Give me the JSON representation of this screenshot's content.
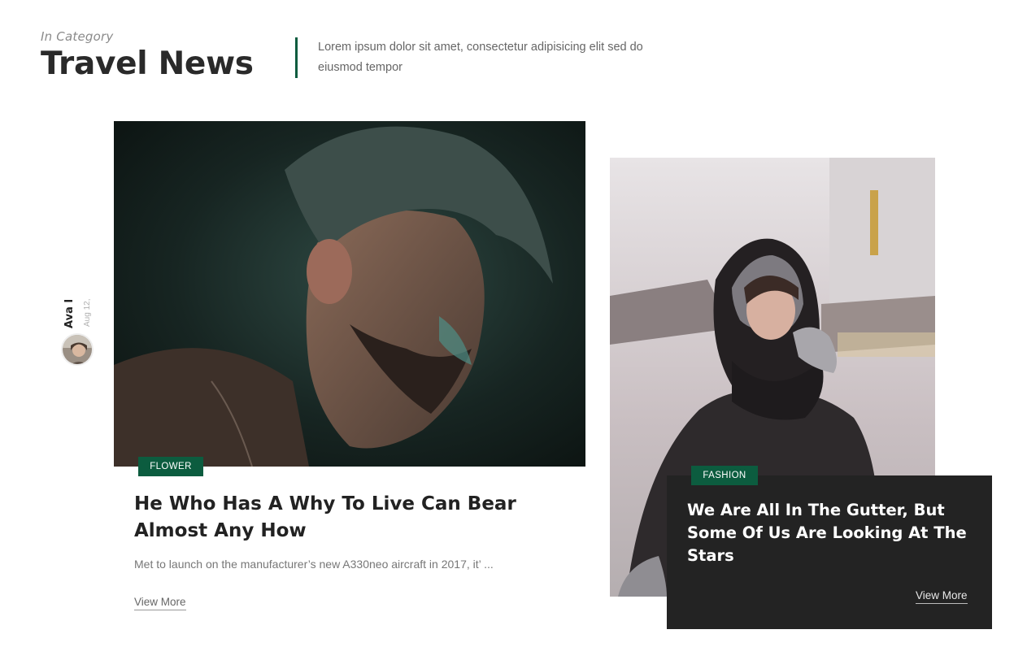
{
  "section": {
    "eyebrow": "In Category",
    "title": "Travel News",
    "description": "Lorem ipsum dolor sit amet, consectetur adipisicing elit sed do eiusmod tempor"
  },
  "author": {
    "name": "Ava I",
    "date": "Aug 12,"
  },
  "main_post": {
    "image_alt": "man with beard in dim light",
    "tag": "FLOWER",
    "title": "He Who Has A Why To Live Can Bear Almost Any How",
    "excerpt": "Met to launch on the manufacturer’s new A330neo aircraft in 2017, it’ ...",
    "link": "View More"
  },
  "side_post": {
    "image_alt": "woman in hood on snowy street",
    "tag": "FASHION",
    "title": "We Are All In The Gutter, But Some Of Us Are Looking At The Stars",
    "link": "View More"
  },
  "colors": {
    "accent": "#0c5c3f",
    "overlay": "#232323"
  }
}
